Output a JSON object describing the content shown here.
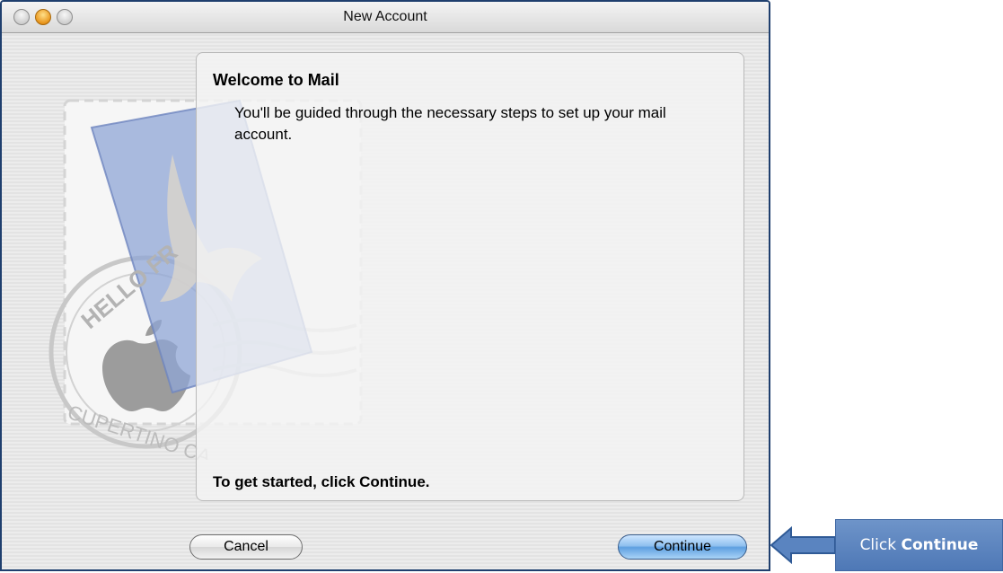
{
  "window": {
    "title": "New Account"
  },
  "stamp": {
    "postmark_top": "HELLO FR",
    "postmark_bottom": "CUPERTINO CA"
  },
  "panel": {
    "heading": "Welcome to Mail",
    "body": "You'll be guided through the necessary steps to set up your mail account.",
    "footer": "To get started, click Continue."
  },
  "buttons": {
    "cancel_label": "Cancel",
    "continue_label": "Continue"
  },
  "callout": {
    "prefix": "Click",
    "target": "Continue"
  },
  "colors": {
    "window_border": "#1f3f6e",
    "continue_button": "#5e9fe0",
    "callout_fill": "#4e78b6"
  }
}
